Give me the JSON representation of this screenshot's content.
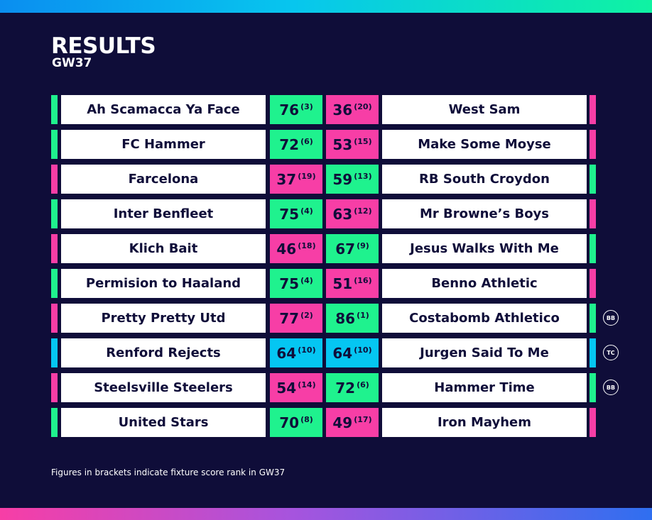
{
  "header": {
    "title": "RESULTS",
    "subtitle": "GW37"
  },
  "colors": {
    "green": "#1ff28e",
    "pink": "#f73ea6",
    "blue": "#05c6f2",
    "navy": "#0f0d39",
    "white": "#ffffff"
  },
  "fixtures": [
    {
      "home": "Ah Scamacca Ya Face",
      "home_score": "76",
      "home_rank": "(3)",
      "away_score": "36",
      "away_rank": "(20)",
      "away": "West Sam",
      "result": "home",
      "chip": ""
    },
    {
      "home": "FC Hammer",
      "home_score": "72",
      "home_rank": "(6)",
      "away_score": "53",
      "away_rank": "(15)",
      "away": "Make Some Moyse",
      "result": "home",
      "chip": ""
    },
    {
      "home": "Farcelona",
      "home_score": "37",
      "home_rank": "(19)",
      "away_score": "59",
      "away_rank": "(13)",
      "away": "RB South Croydon",
      "result": "away",
      "chip": ""
    },
    {
      "home": "Inter Benfleet",
      "home_score": "75",
      "home_rank": "(4)",
      "away_score": "63",
      "away_rank": "(12)",
      "away": "Mr Browne’s Boys",
      "result": "home",
      "chip": ""
    },
    {
      "home": "Klich Bait",
      "home_score": "46",
      "home_rank": "(18)",
      "away_score": "67",
      "away_rank": "(9)",
      "away": "Jesus Walks With Me",
      "result": "away",
      "chip": ""
    },
    {
      "home": "Permision to Haaland",
      "home_score": "75",
      "home_rank": "(4)",
      "away_score": "51",
      "away_rank": "(16)",
      "away": "Benno Athletic",
      "result": "home",
      "chip": ""
    },
    {
      "home": "Pretty Pretty Utd",
      "home_score": "77",
      "home_rank": "(2)",
      "away_score": "86",
      "away_rank": "(1)",
      "away": "Costabomb Athletico",
      "result": "away",
      "chip": "BB"
    },
    {
      "home": "Renford Rejects",
      "home_score": "64",
      "home_rank": "(10)",
      "away_score": "64",
      "away_rank": "(10)",
      "away": "Jurgen Said To Me",
      "result": "draw",
      "chip": "TC"
    },
    {
      "home": "Steelsville Steelers",
      "home_score": "54",
      "home_rank": "(14)",
      "away_score": "72",
      "away_rank": "(6)",
      "away": "Hammer Time",
      "result": "away",
      "chip": "BB"
    },
    {
      "home": "United Stars",
      "home_score": "70",
      "home_rank": "(8)",
      "away_score": "49",
      "away_rank": "(17)",
      "away": "Iron Mayhem",
      "result": "home",
      "chip": ""
    }
  ],
  "footnote": "Figures in brackets indicate fixture score rank in GW37"
}
